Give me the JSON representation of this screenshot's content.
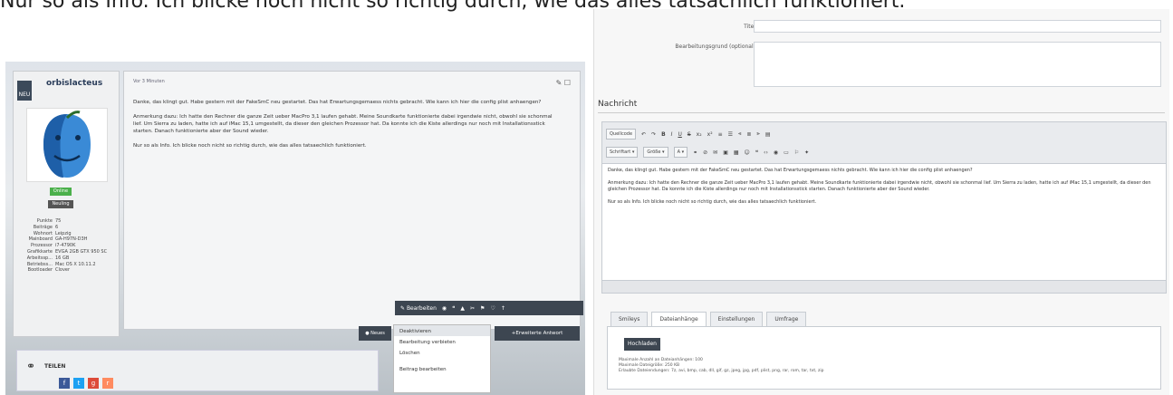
{
  "intro_text": "Nur so als Info. Ich blicke noch nicht so richtig durch, wie das alles tatsächlich funktioniert.",
  "post": {
    "username": "orbislacteus",
    "new_badge": "NEU",
    "status_online": "Online",
    "status_rank": "Neuling",
    "time": "Vor 3 Minuten",
    "paragraphs": [
      "Danke, das klingt gut. Habe gestern mit der FakeSmC neu gestartet. Das hat Erwartungsgemaess nichts gebracht. Wie kann ich hier die config plist anhaengen?",
      "Anmerkung dazu: Ich hatte den Rechner die ganze Zeit ueber MacPro 3,1 laufen gehabt. Meine Soundkarte funktionierte dabei irgendwie nicht, obwohl sie schonmal lief. Um Sierra zu laden, hatte ich auf iMac 15,1 umgestellt, da dieser den gleichen Prozessor hat. Da konnte ich die Kiste allerdings nur noch mit Installationsstick starten. Danach funktionierte aber der Sound wieder.",
      "Nur so als Info. Ich blicke noch nicht so richtig durch, wie das alles tatsaechlich funktioniert."
    ],
    "specs": [
      {
        "k": "Punkte",
        "v": "75"
      },
      {
        "k": "Beiträge",
        "v": "6"
      },
      {
        "k": "Wohnort",
        "v": "Leipzig"
      },
      {
        "k": "Mainboard",
        "v": "GA-H97N-D3H"
      },
      {
        "k": "Prozessor",
        "v": "i7-4790K"
      },
      {
        "k": "Grafikkarte",
        "v": "EVGA 2GB GTX 950 SC"
      },
      {
        "k": "Arbeitssp...",
        "v": "16 GB"
      },
      {
        "k": "Betriebss...",
        "v": "Mac OS X 10.11.2"
      },
      {
        "k": "Bootloader",
        "v": "Clover"
      }
    ],
    "toolbar_edit": "Bearbeiten",
    "news_button": "Neues",
    "extended_reply": "Erweiterte Antwort",
    "menu_items": [
      "Deaktivieren",
      "Bearbeitung verbieten",
      "Löschen",
      "Beitrag bearbeiten"
    ],
    "share_label": "TEILEN"
  },
  "editor": {
    "title_label": "Titel",
    "reason_label": "Bearbeitungsgrund (optional)",
    "section": "Nachricht",
    "row1": [
      "Quellcode",
      "B",
      "I",
      "U",
      "S",
      "x₂",
      "x²"
    ],
    "row2": [
      "Schriftart",
      "Größe",
      "A"
    ],
    "paragraphs": [
      "Danke, das klingt gut. Habe gestern mit der FakeSmC neu gestartet. Das hat Erwartungsgemaess nichts gebracht. Wie kann ich hier die config plist anhaengen?",
      "Anmerkung dazu: Ich hatte den Rechner die ganze Zeit ueber MacPro 3,1 laufen gehabt. Meine Soundkarte funktionierte dabei irgendwie nicht, obwohl sie schonmal lief. Um Sierra zu laden, hatte ich auf iMac 15,1 umgestellt, da dieser den gleichen Prozessor hat. Da konnte ich die Kiste allerdings nur noch mit Installationsstick starten. Danach funktionierte aber der Sound wieder.",
      "Nur so als Info. Ich blicke noch nicht so richtig durch, wie das alles tatsaechlich funktioniert."
    ],
    "tabs": [
      "Smileys",
      "Dateianhänge",
      "Einstellungen",
      "Umfrage"
    ],
    "active_tab": 1,
    "upload_button": "Hochladen",
    "info_lines": [
      "Maximale Anzahl an Dateianhängen: 100",
      "Maximale Dateigröße: 250 KB",
      "Erlaubte Dateiendungen: 7z, avi, bmp, cab, dll, gif, gz, jpeg, jpg, pdf, plist, png, rar, rom, tar, txt, zip"
    ]
  }
}
